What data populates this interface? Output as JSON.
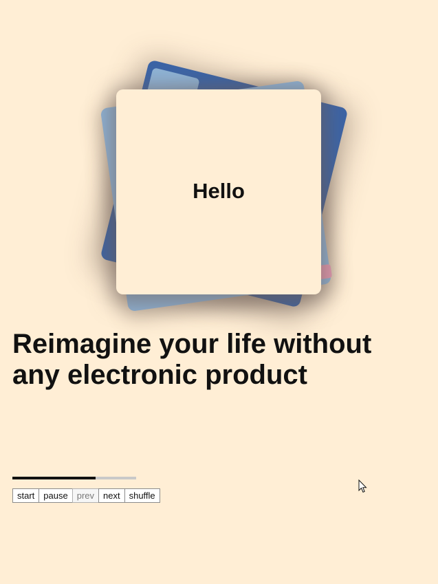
{
  "card_stack": {
    "front_text": "Hello",
    "colors": {
      "front": "#ffeed5",
      "back_dark_blue": "#3c64a6",
      "back_light_blue": "#8fb3d6",
      "accent_pink": "#e59ab2"
    }
  },
  "headline": "Reimagine your life without any electronic product",
  "progress": {
    "fraction": 0.67
  },
  "controls": {
    "start_label": "start",
    "pause_label": "pause",
    "prev_label": "prev",
    "next_label": "next",
    "shuffle_label": "shuffle",
    "prev_disabled": true
  },
  "theme": {
    "background": "#ffeed5",
    "text": "#111111"
  }
}
